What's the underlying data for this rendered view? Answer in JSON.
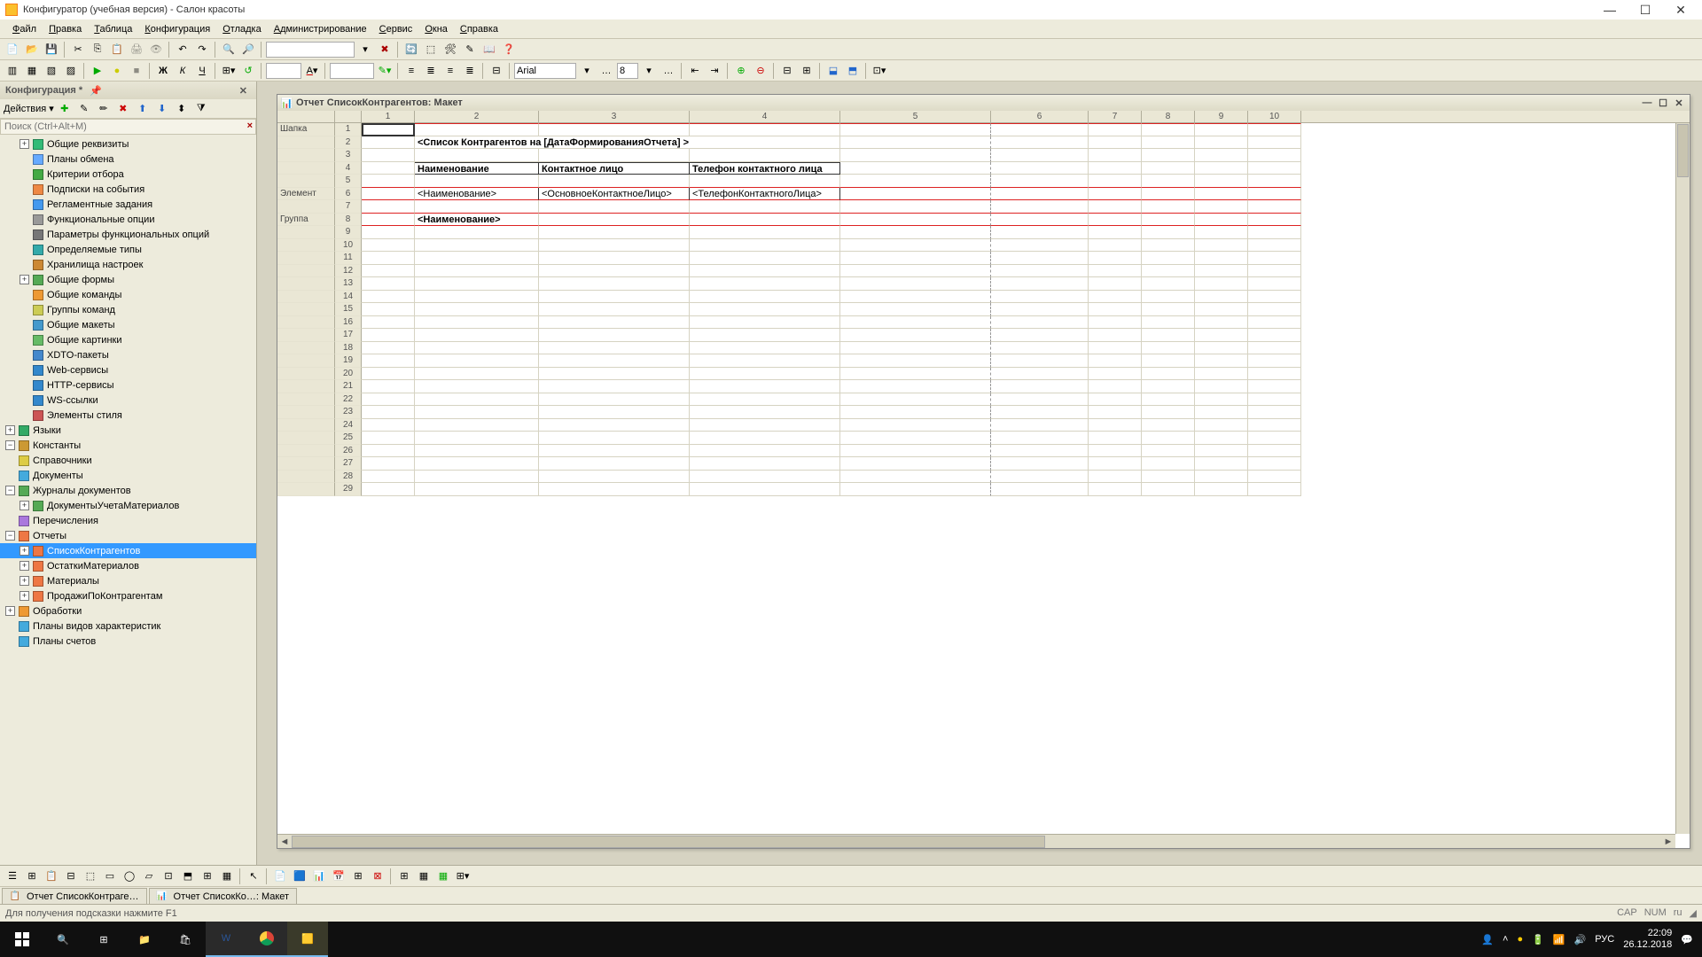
{
  "title": "Конфигуратор (учебная версия) - Салон красоты",
  "menu": [
    "Файл",
    "Правка",
    "Таблица",
    "Конфигурация",
    "Отладка",
    "Администрирование",
    "Сервис",
    "Окна",
    "Справка"
  ],
  "configPanel": {
    "header": "Конфигурация *",
    "actions_label": "Действия ▾",
    "search_placeholder": "Поиск (Ctrl+Alt+M)"
  },
  "tree": [
    {
      "lvl": 1,
      "exp": "+",
      "icon": "#3b7",
      "label": "Общие реквизиты"
    },
    {
      "lvl": 1,
      "exp": "",
      "icon": "#6af",
      "label": "Планы обмена"
    },
    {
      "lvl": 1,
      "exp": "",
      "icon": "#4a4",
      "label": "Критерии отбора"
    },
    {
      "lvl": 1,
      "exp": "",
      "icon": "#e84",
      "label": "Подписки на события"
    },
    {
      "lvl": 1,
      "exp": "",
      "icon": "#49e",
      "label": "Регламентные задания"
    },
    {
      "lvl": 1,
      "exp": "",
      "icon": "#999",
      "label": "Функциональные опции"
    },
    {
      "lvl": 1,
      "exp": "",
      "icon": "#777",
      "label": "Параметры функциональных опций"
    },
    {
      "lvl": 1,
      "exp": "",
      "icon": "#3aa",
      "label": "Определяемые типы"
    },
    {
      "lvl": 1,
      "exp": "",
      "icon": "#c83",
      "label": "Хранилища настроек"
    },
    {
      "lvl": 1,
      "exp": "+",
      "icon": "#5a5",
      "label": "Общие формы"
    },
    {
      "lvl": 1,
      "exp": "",
      "icon": "#e93",
      "label": "Общие команды"
    },
    {
      "lvl": 1,
      "exp": "",
      "icon": "#cc5",
      "label": "Группы команд"
    },
    {
      "lvl": 1,
      "exp": "",
      "icon": "#49c",
      "label": "Общие макеты"
    },
    {
      "lvl": 1,
      "exp": "",
      "icon": "#6b6",
      "label": "Общие картинки"
    },
    {
      "lvl": 1,
      "exp": "",
      "icon": "#48c",
      "label": "XDTO-пакеты"
    },
    {
      "lvl": 1,
      "exp": "",
      "icon": "#38c",
      "label": "Web-сервисы"
    },
    {
      "lvl": 1,
      "exp": "",
      "icon": "#38c",
      "label": "HTTP-сервисы"
    },
    {
      "lvl": 1,
      "exp": "",
      "icon": "#38c",
      "label": "WS-ссылки"
    },
    {
      "lvl": 1,
      "exp": "",
      "icon": "#c55",
      "label": "Элементы стиля"
    },
    {
      "lvl": 0,
      "exp": "+",
      "icon": "#3a6",
      "label": "Языки"
    },
    {
      "lvl": 0,
      "exp": "−",
      "icon": "#c93",
      "label": "Константы"
    },
    {
      "lvl": 0,
      "exp": "",
      "icon": "#dc4",
      "label": "Справочники"
    },
    {
      "lvl": 0,
      "exp": "",
      "icon": "#4ad",
      "label": "Документы"
    },
    {
      "lvl": 0,
      "exp": "−",
      "icon": "#5a5",
      "label": "Журналы документов"
    },
    {
      "lvl": 1,
      "exp": "+",
      "icon": "#5a5",
      "label": "ДокументыУчетаМатериалов"
    },
    {
      "lvl": 0,
      "exp": "",
      "icon": "#a7d",
      "label": "Перечисления"
    },
    {
      "lvl": 0,
      "exp": "−",
      "icon": "#e74",
      "label": "Отчеты"
    },
    {
      "lvl": 1,
      "exp": "+",
      "icon": "#e74",
      "label": "СписокКонтрагентов",
      "selected": true
    },
    {
      "lvl": 1,
      "exp": "+",
      "icon": "#e74",
      "label": "ОстаткиМатериалов"
    },
    {
      "lvl": 1,
      "exp": "+",
      "icon": "#e74",
      "label": "Материалы"
    },
    {
      "lvl": 1,
      "exp": "+",
      "icon": "#e74",
      "label": "ПродажиПоКонтрагентам"
    },
    {
      "lvl": 0,
      "exp": "+",
      "icon": "#e93",
      "label": "Обработки"
    },
    {
      "lvl": 0,
      "exp": "",
      "icon": "#4ad",
      "label": "Планы видов характеристик"
    },
    {
      "lvl": 0,
      "exp": "",
      "icon": "#4ad",
      "label": "Планы счетов"
    }
  ],
  "docTitle": "Отчет СписокКонтрагентов: Макет",
  "columns": [
    60,
    140,
    170,
    170,
    170,
    110,
    60,
    60,
    60,
    60,
    60,
    60
  ],
  "colLabels": [
    "1",
    "2",
    "3",
    "4",
    "5",
    "6",
    "7",
    "8",
    "9",
    "10"
  ],
  "sheetRows": 29,
  "sections": {
    "1": "Шапка",
    "6": "Элемент",
    "8": "Группа"
  },
  "cells": {
    "r2c2": "<Список Контрагентов на [ДатаФормированияОтчета] >",
    "r4c2": "Наименование",
    "r4c3": "Контактное лицо",
    "r4c4": "Телефон контактного лица",
    "r6c2": "<Наименование>",
    "r6c3": "<ОсновноеКонтактноеЛицо>",
    "r6c4": "<ТелефонКонтактногоЛица>",
    "r8c2": "<Наименование>"
  },
  "toolbar2": {
    "font": "Arial",
    "size": "8"
  },
  "tabs": [
    "Отчет СписокКонтраге…",
    "Отчет СписокКо…: Макет"
  ],
  "status": "Для получения подсказки нажмите F1",
  "statusRight": {
    "cap": "CAP",
    "num": "NUM",
    "lang": "ru"
  },
  "taskbar": {
    "time": "22:09",
    "date": "26.12.2018",
    "lang": "РУС"
  }
}
